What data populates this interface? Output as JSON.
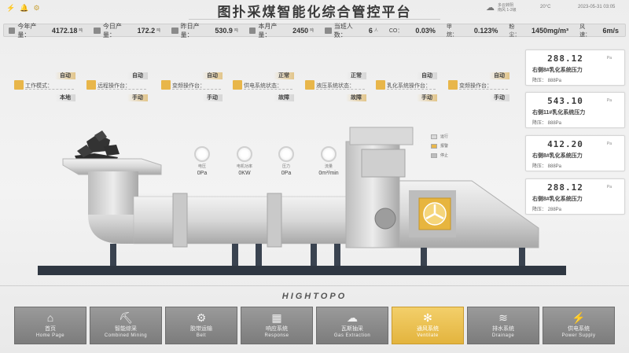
{
  "header": {
    "icons": [
      "bolt-icon",
      "bell-icon",
      "settings-icon"
    ],
    "title": "图扑采煤智能化综合管控平台",
    "weather_icon": "cloud-icon",
    "weather_line1": "多云转阴",
    "weather_line2": "南风 1-2级",
    "temp": "20°C",
    "datetime": "2023-05-31 03:05"
  },
  "stats": [
    {
      "icon": "mine-icon",
      "label": "今年产量：",
      "value": "4172.18",
      "unit": "吨"
    },
    {
      "icon": "mine-icon",
      "label": "今日产量：",
      "value": "172.2",
      "unit": "吨"
    },
    {
      "icon": "mine-icon",
      "label": "昨日产量：",
      "value": "530.9",
      "unit": "吨"
    },
    {
      "icon": "mine-icon",
      "label": "本月产量：",
      "value": "2450",
      "unit": "吨"
    },
    {
      "icon": "person-icon",
      "label": "当班人数：",
      "value": "6",
      "unit": "人"
    }
  ],
  "gas": [
    {
      "label": "CO：",
      "value": "0.03%"
    },
    {
      "label": "甲烷：",
      "value": "0.123%"
    },
    {
      "label": "粉尘：",
      "value": "1450mg/m³"
    },
    {
      "label": "风速：",
      "value": "6m/s"
    }
  ],
  "cards": [
    {
      "label": "工作模式：",
      "top": "自动",
      "bottom": "本地",
      "top_warn": true,
      "bottom_warn": false
    },
    {
      "label": "远程操作台：",
      "top": "自动",
      "bottom": "手动",
      "top_warn": false,
      "bottom_warn": true
    },
    {
      "label": "变频操作台：",
      "top": "自动",
      "bottom": "手动",
      "top_warn": true,
      "bottom_warn": false
    },
    {
      "label": "供电系统状态：",
      "top": "正常",
      "bottom": "故障",
      "top_warn": true,
      "bottom_warn": false
    },
    {
      "label": "液压系统状态：",
      "top": "正常",
      "bottom": "故障",
      "top_warn": false,
      "bottom_warn": true
    },
    {
      "label": "乳化系统操作台：",
      "top": "自动",
      "bottom": "手动",
      "top_warn": false,
      "bottom_warn": true
    },
    {
      "label": "变频操作台：",
      "top": "自动",
      "bottom": "手动",
      "top_warn": true,
      "bottom_warn": false
    }
  ],
  "pressure": [
    {
      "value": "288.12",
      "unit": "Pa",
      "label": "右侧8#乳化系统压力",
      "delta": "降压：  888Pa"
    },
    {
      "value": "543.10",
      "unit": "Pa",
      "label": "右侧11#乳化系统压力",
      "delta": "降压：  888Pa"
    },
    {
      "value": "412.20",
      "unit": "Pa",
      "label": "右侧8#乳化系统压力",
      "delta": "降压：  888Pa"
    },
    {
      "value": "288.12",
      "unit": "Pa",
      "label": "右侧8#乳化系统压力",
      "delta": "降压：  288Pa"
    }
  ],
  "legend": [
    {
      "label": "运行",
      "color": "#d9d9d9"
    },
    {
      "label": "报警",
      "color": "#e8b64a"
    },
    {
      "label": "停止",
      "color": "#bdbdbd"
    }
  ],
  "gauges": [
    {
      "label": "电压",
      "value": "0Pa"
    },
    {
      "label": "电机功率",
      "value": "0KW"
    },
    {
      "label": "压力",
      "value": "0Pa"
    },
    {
      "label": "流量",
      "value": "0m³/min"
    }
  ],
  "brand": "HIGHTOPO",
  "nav": [
    {
      "icon": "home-icon",
      "zh": "首页",
      "en": "Home Page",
      "active": false
    },
    {
      "icon": "mining-icon",
      "zh": "智能综采",
      "en": "Combined Mining",
      "active": false
    },
    {
      "icon": "belt-icon",
      "zh": "胶带运输",
      "en": "Belt",
      "active": false
    },
    {
      "icon": "response-icon",
      "zh": "响应系统",
      "en": "Response",
      "active": false
    },
    {
      "icon": "gas-icon",
      "zh": "瓦斯抽采",
      "en": "Gas Extraction",
      "active": false
    },
    {
      "icon": "ventilate-icon",
      "zh": "通风系统",
      "en": "Ventilate",
      "active": true
    },
    {
      "icon": "drainage-icon",
      "zh": "排水系统",
      "en": "Drainage",
      "active": false
    },
    {
      "icon": "power-icon",
      "zh": "供电系统",
      "en": "Power Supply",
      "active": false
    }
  ]
}
